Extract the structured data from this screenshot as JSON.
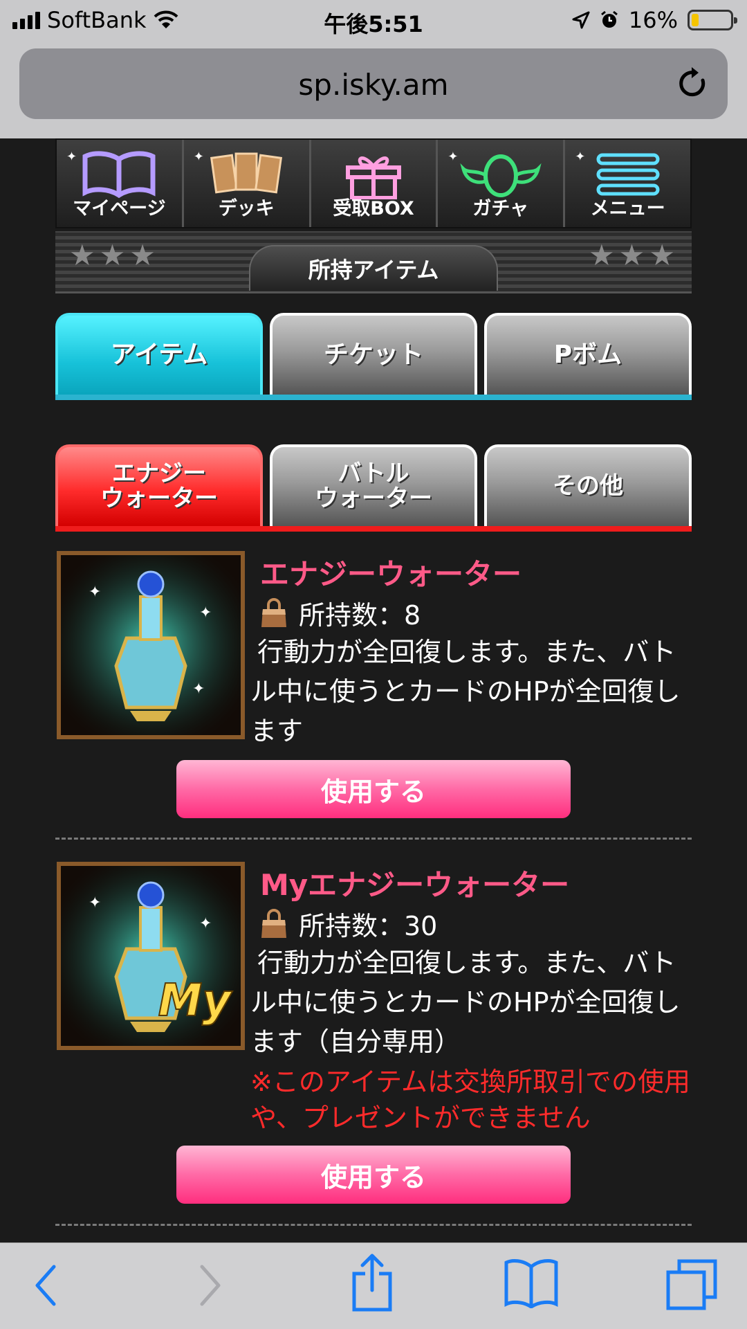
{
  "status_bar": {
    "carrier": "SoftBank",
    "time": "午後5:51",
    "battery_percent": "16%",
    "battery_level": 0.16
  },
  "browser": {
    "url": "sp.isky.am"
  },
  "nav": {
    "items": [
      {
        "label": "マイページ",
        "icon": "book-icon"
      },
      {
        "label": "デッキ",
        "icon": "cards-icon"
      },
      {
        "label": "受取BOX",
        "icon": "gift-icon"
      },
      {
        "label": "ガチャ",
        "icon": "egg-wings-icon"
      },
      {
        "label": "メニュー",
        "icon": "menu-icon"
      }
    ]
  },
  "section_title": "所持アイテム",
  "category_tabs": [
    "アイテム",
    "チケット",
    "Pボム"
  ],
  "sub_tabs": [
    "エナジー\nウォーター",
    "バトル\nウォーター",
    "その他"
  ],
  "items": [
    {
      "name": "エナジーウォーター",
      "owned_label": "所持数：8",
      "description": "行動力が全回復します。また、バトル中に使うとカードのHPが全回復します",
      "warning": "",
      "button": "使用する"
    },
    {
      "name": "Myエナジーウォーター",
      "owned_label": "所持数：30",
      "description": "行動力が全回復します。また、バトル中に使うとカードのHPが全回復します（自分専用）",
      "warning": "※このアイテムは交換所取引での使用や、プレゼントができません",
      "badge": "My",
      "button": "使用する"
    }
  ],
  "colors": {
    "accent_pink": "#ff5a88",
    "tab_cyan": "#17c2d9",
    "tab_red": "#ff2c2c",
    "warning_red": "#ff2b2b"
  }
}
